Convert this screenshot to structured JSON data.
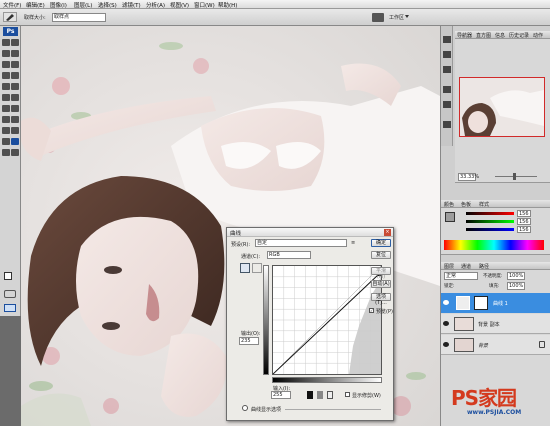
{
  "menubar": {
    "items": [
      "文件(F)",
      "编辑(E)",
      "图像(I)",
      "图层(L)",
      "选择(S)",
      "滤镜(T)",
      "分析(A)",
      "视图(V)",
      "窗口(W)",
      "帮助(H)"
    ]
  },
  "options": {
    "sample_label": "取样大小:",
    "sample_value": "取样点",
    "workspace_label": "工作区"
  },
  "tools": {
    "logo": "Ps"
  },
  "navigator": {
    "tabs": [
      "导航器",
      "直方图",
      "信息",
      "历史记录",
      "动作"
    ],
    "zoom": "33.33%"
  },
  "color": {
    "tabs": [
      "颜色",
      "色板",
      "样式"
    ],
    "values": [
      "156",
      "156",
      "156"
    ]
  },
  "layers": {
    "tabs": [
      "图层",
      "通道",
      "路径"
    ],
    "blend_mode": "正常",
    "opacity_label": "不透明度:",
    "opacity": "100%",
    "lock_label": "锁定:",
    "fill_label": "填充:",
    "fill": "100%",
    "items": [
      "曲线 1",
      "背景 副本",
      "背景"
    ]
  },
  "curves": {
    "title": "曲线",
    "preset_label": "预设(R):",
    "preset_value": "自定",
    "channel_label": "通道(C):",
    "channel_value": "RGB",
    "output_label": "输出(O):",
    "output_value": "235",
    "input_label": "输入(I):",
    "input_value": "255",
    "show_clipping": "显示修剪(W)",
    "display_options": "曲线显示选项",
    "buttons": [
      "确定",
      "复位",
      "平滑(M)",
      "自动(A)",
      "选项(T)..."
    ],
    "preview": "预览(P)"
  },
  "brand": {
    "name": "PS家园",
    "url": "www.PSJIA.COM"
  },
  "colors": {
    "accent": "#1b4e9e",
    "layer_selected": "#3a8de0",
    "brand_red": "#d43a1e"
  }
}
